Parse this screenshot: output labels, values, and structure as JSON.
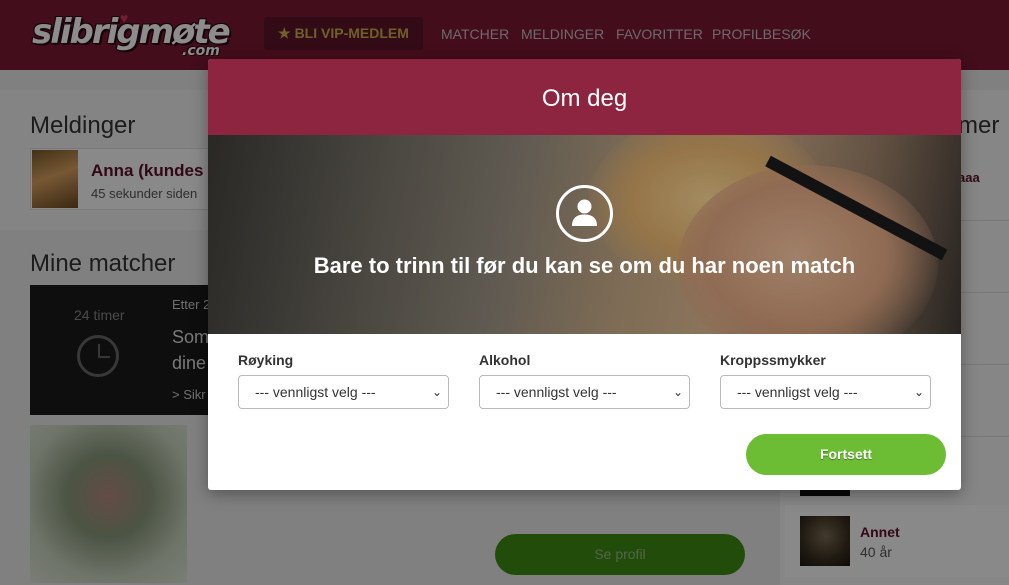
{
  "header": {
    "logo_main": "slibrigmøte",
    "logo_sub": ".com",
    "vip_label": "BLI VIP-MEDLEM",
    "nav": [
      "MATCHER",
      "MELDINGER",
      "FAVORITTER",
      "PROFILBESØK"
    ]
  },
  "background": {
    "messages_title": "Meldinger",
    "message": {
      "name": "Anna (kundes",
      "time": "45 sekunder siden"
    },
    "matches_title": "Mine matcher",
    "timer": {
      "label": "24 timer",
      "after": "Etter 2",
      "line1": "Som",
      "line2": "dine",
      "link": "> Sikr"
    },
    "see_profile": "Se profil",
    "right_title": "mer",
    "right_name_partial": "aaa",
    "right_person": {
      "name": "Annet",
      "age": "40 år"
    }
  },
  "modal": {
    "title": "Om deg",
    "hero_text": "Bare to trinn til før du kan se om du har noen match",
    "fields": [
      {
        "label": "Røyking",
        "value": "--- vennligst velg ---"
      },
      {
        "label": "Alkohol",
        "value": "--- vennligst velg ---"
      },
      {
        "label": "Kroppssmykker",
        "value": "--- vennligst velg ---"
      }
    ],
    "continue_label": "Fortsett"
  },
  "colors": {
    "header": "#7a1832",
    "modal_header": "#8d2540",
    "continue_button": "#6cbd34",
    "name_text": "#5a1026"
  },
  "icons": [
    "star-icon",
    "user-icon",
    "clock-icon",
    "chevron-down-icon"
  ]
}
